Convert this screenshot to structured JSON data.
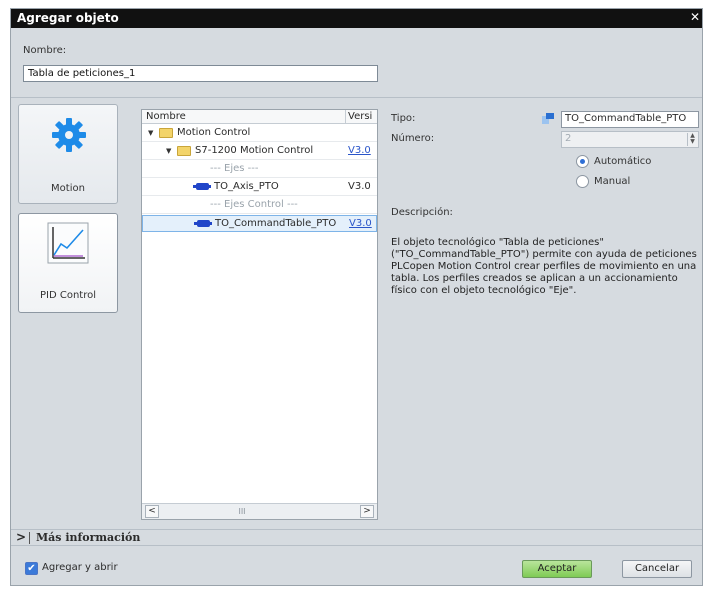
{
  "dialog": {
    "title": "Agregar objeto",
    "close_glyph": "✕"
  },
  "name_label": "Nombre:",
  "name_value": "Tabla de peticiones_1",
  "palette": {
    "tiles": [
      {
        "label": "Motion",
        "icon": "gear-icon"
      },
      {
        "label": "PID Control",
        "icon": "chart-icon"
      }
    ]
  },
  "tree": {
    "columns": {
      "name": "Nombre",
      "version": "Versi"
    },
    "rows": [
      {
        "label": "Motion Control",
        "version": "",
        "kind": "folder"
      },
      {
        "label": "S7-1200 Motion Control",
        "version": "V3.0",
        "kind": "folder"
      },
      {
        "label": "--- Ejes ---",
        "version": "",
        "kind": "section"
      },
      {
        "label": "TO_Axis_PTO",
        "version": "V3.0",
        "kind": "object"
      },
      {
        "label": "--- Ejes Control ---",
        "version": "",
        "kind": "section"
      },
      {
        "label": "TO_CommandTable_PTO",
        "version": "V3.0",
        "kind": "object"
      }
    ],
    "scroll_left": "<",
    "scroll_right": ">",
    "scroll_thumb": "III"
  },
  "detail": {
    "tipo_label": "Tipo:",
    "tipo_value": "TO_CommandTable_PTO",
    "numero_label": "Número:",
    "numero_value": "2",
    "radio_auto": "Automático",
    "radio_manual": "Manual",
    "desc_label": "Descripción:",
    "desc_text": "El objeto tecnológico \"Tabla de peticiones\" (\"TO_CommandTable_PTO\") permite con ayuda de peticiones PLCopen Motion Control crear perfiles de movimiento en una tabla. Los perfiles creados se aplican a un accionamiento físico con el objeto tecnológico \"Eje\"."
  },
  "more_info": {
    "arrow": ">",
    "label": "Más información"
  },
  "footer": {
    "checkbox_label": "Agregar y abrir",
    "checkbox_checked": true,
    "ok_label": "Aceptar",
    "cancel_label": "Cancelar"
  }
}
